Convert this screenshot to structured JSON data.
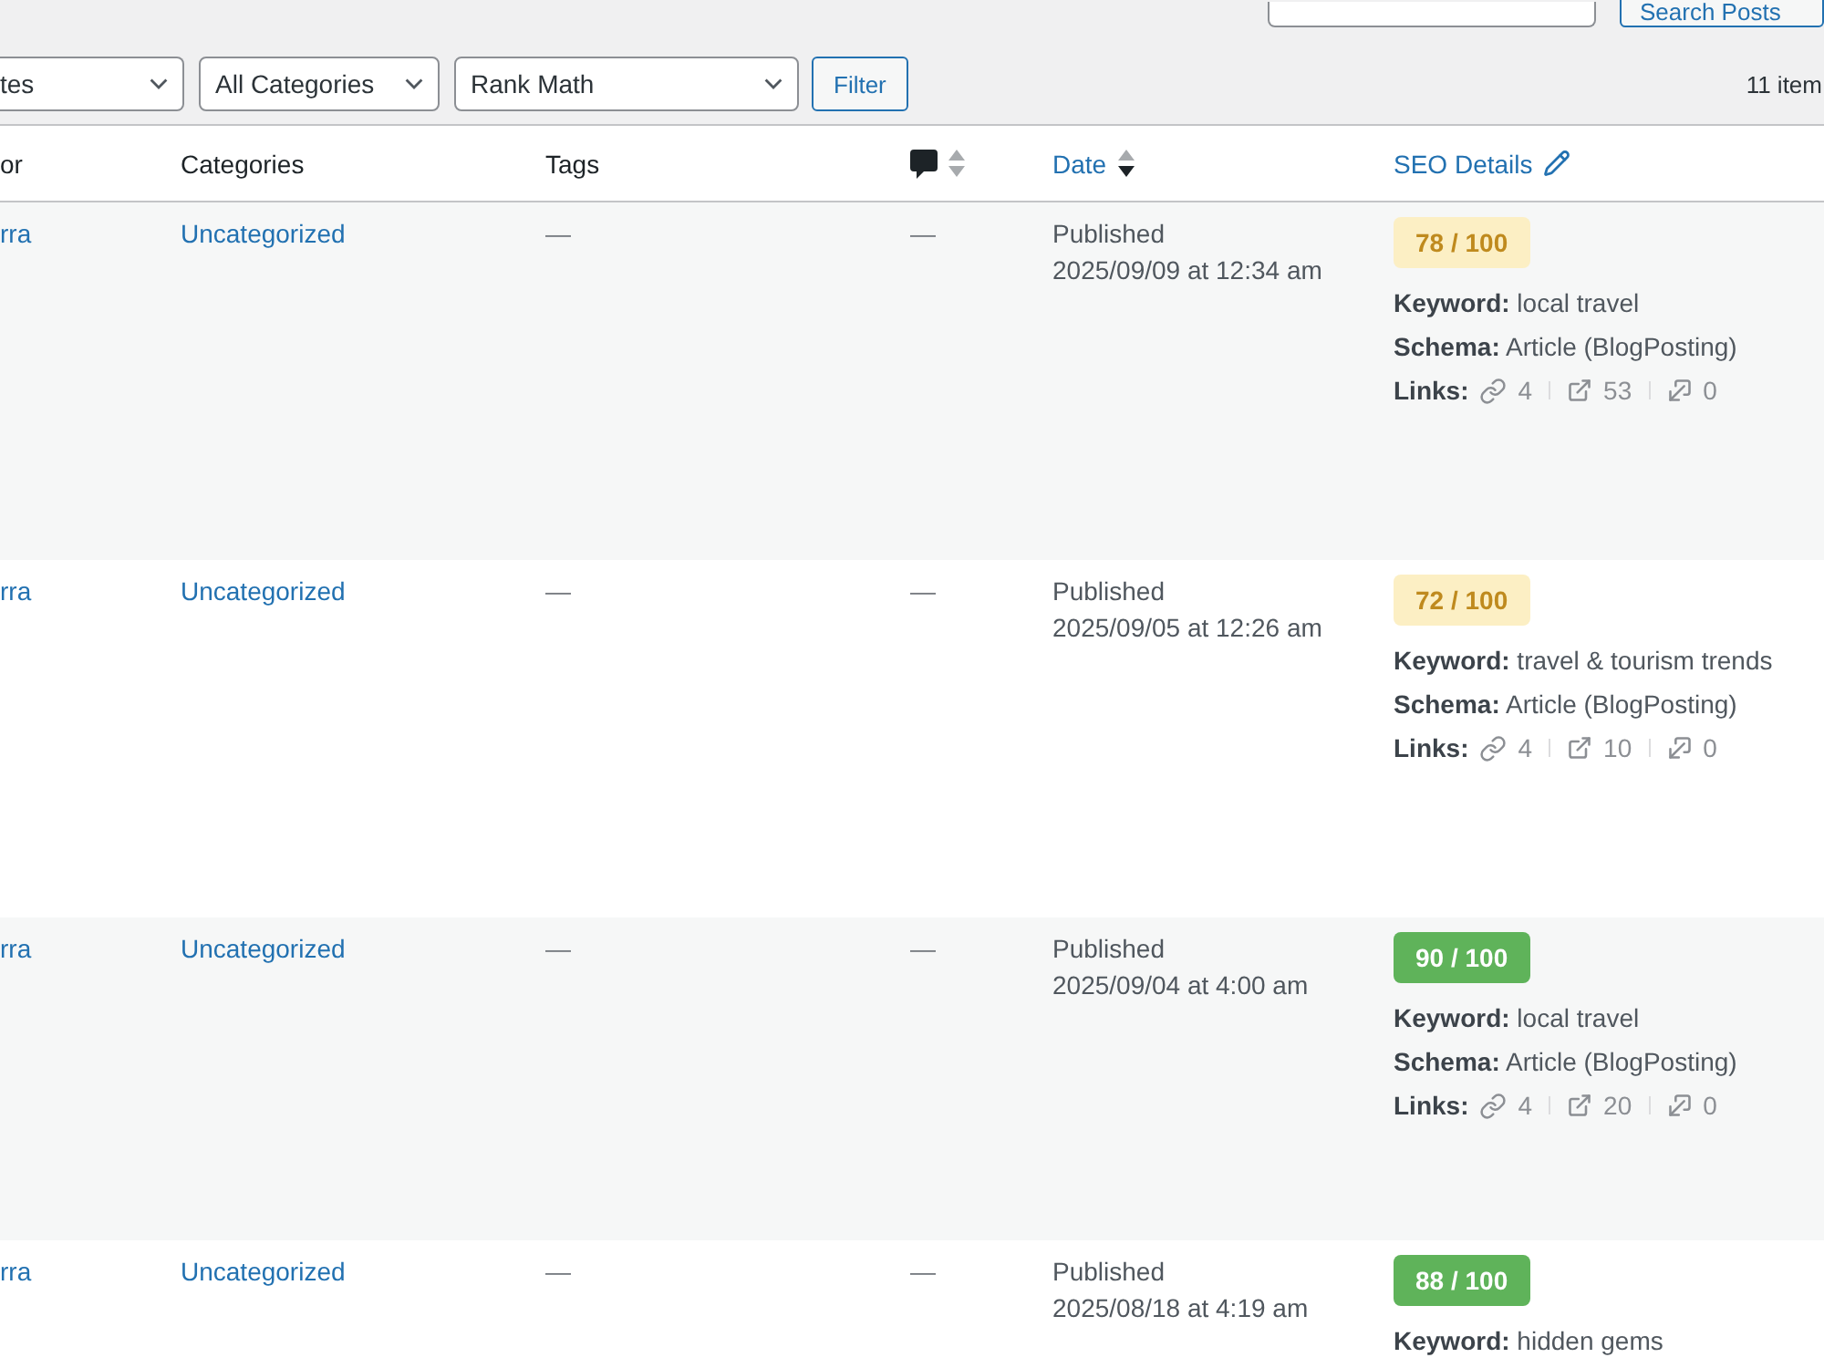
{
  "search": {
    "button": "Search Posts"
  },
  "filters": {
    "dropdowns": [
      {
        "value": "tes"
      },
      {
        "value": "All Categories"
      },
      {
        "value": "Rank Math"
      }
    ],
    "button": "Filter"
  },
  "item_count": "11 item",
  "table": {
    "columns": [
      {
        "label": "or",
        "kind": "text"
      },
      {
        "label": "Categories",
        "kind": "text"
      },
      {
        "label": "Tags",
        "kind": "text"
      },
      {
        "kind": "comments",
        "sorted": false
      },
      {
        "label": "Date",
        "kind": "sortable",
        "sorted": true
      },
      {
        "label": "SEO Details",
        "kind": "editable"
      }
    ],
    "rows": [
      {
        "author": "rra",
        "category": "Uncategorized",
        "tags": "—",
        "comments": "—",
        "status": "Published",
        "date": "2025/09/09 at 12:34 am",
        "seo": {
          "score": "78 / 100",
          "color": "#fcefc4",
          "keyword": "**Keyword:** local travel",
          "schema": "**Schema:** Article (BlogPosting)",
          "links_label": "Links:",
          "internal": "4",
          "external": "53",
          "incoming": "0"
        }
      },
      {
        "author": "rra",
        "category": "Uncategorized",
        "tags": "—",
        "comments": "—",
        "status": "Published",
        "date": "2025/09/05 at 12:26 am",
        "seo": {
          "score": "72 / 100",
          "color": "#fcefc4",
          "keyword": "**Keyword:** travel & tourism trends",
          "schema": "**Schema:** Article (BlogPosting)",
          "links_label": "Links:",
          "internal": "4",
          "external": "10",
          "incoming": "0"
        }
      },
      {
        "author": "rra",
        "category": "Uncategorized",
        "tags": "—",
        "comments": "—",
        "status": "Published",
        "date": "2025/09/04 at 4:00 am",
        "seo": {
          "score": "90 / 100",
          "color": "#5fb35a",
          "keyword": "**Keyword:** local travel",
          "schema": "**Schema:** Article (BlogPosting)",
          "links_label": "Links:",
          "internal": "4",
          "external": "20",
          "incoming": "0"
        }
      },
      {
        "author": "rra",
        "category": "Uncategorized",
        "tags": "—",
        "comments": "—",
        "status": "Published",
        "date": "2025/08/18 at 4:19 am",
        "seo": {
          "score": "88 / 100",
          "color": "#5fb35a",
          "keyword": "**Keyword:** hidden gems"
        }
      }
    ]
  }
}
